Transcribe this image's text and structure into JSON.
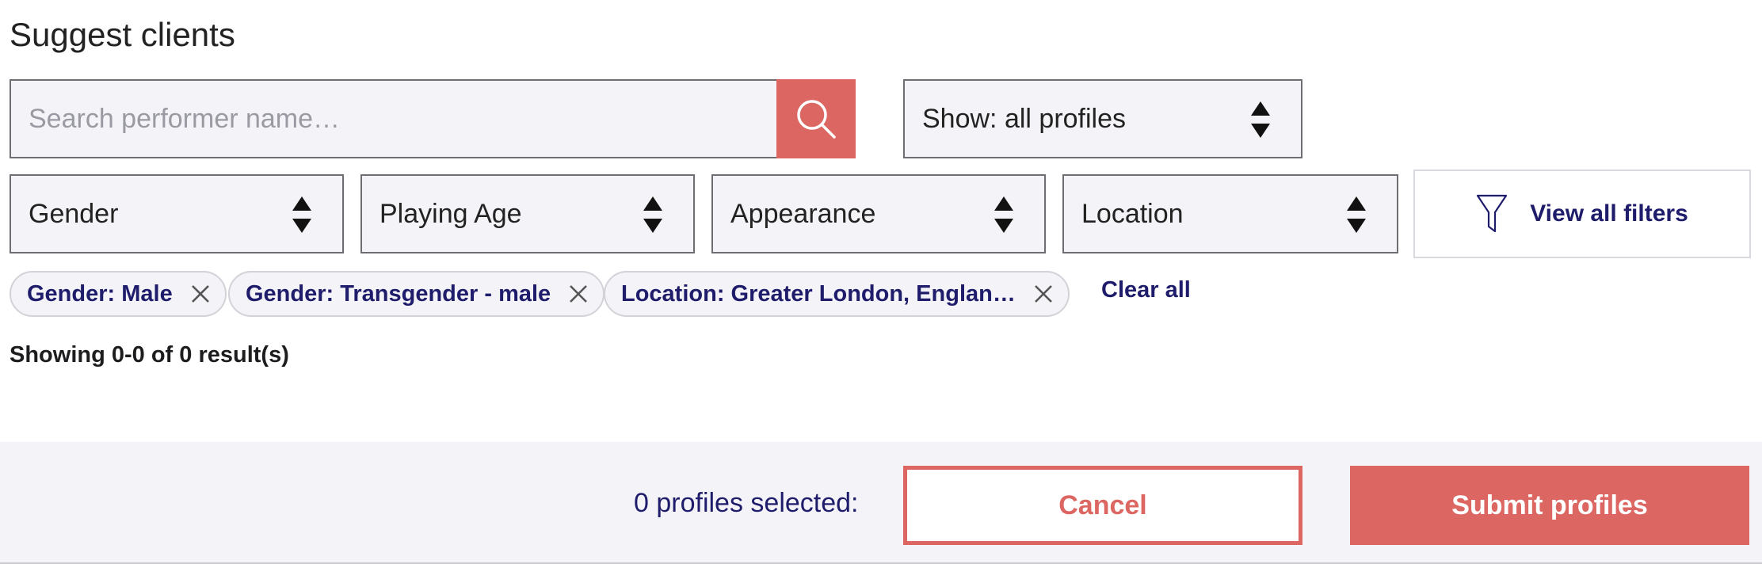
{
  "page": {
    "title": "Suggest clients"
  },
  "search": {
    "placeholder": "Search performer name…",
    "value": "",
    "icon": "search-icon"
  },
  "show_select": {
    "label": "Show: all profiles"
  },
  "filters": {
    "gender": "Gender",
    "playing_age": "Playing Age",
    "appearance": "Appearance",
    "location": "Location",
    "view_all": "View all filters"
  },
  "chips": [
    {
      "label": "Gender: Male"
    },
    {
      "label": "Gender: Transgender - male"
    },
    {
      "label": "Location: Greater London, Englan…"
    }
  ],
  "clear_all": "Clear all",
  "results_text": "Showing 0-0 of 0 result(s)",
  "footer": {
    "selected_text": "0 profiles selected:",
    "cancel_label": "Cancel",
    "submit_label": "Submit profiles"
  },
  "colors": {
    "accent": "#dc6662",
    "link": "#1f1d6b",
    "field_bg": "#f4f4f8"
  }
}
